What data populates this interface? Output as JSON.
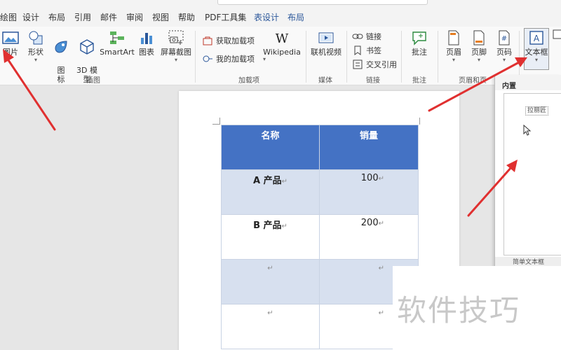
{
  "menu": {
    "tabs": [
      "绘图",
      "设计",
      "布局",
      "引用",
      "邮件",
      "审阅",
      "视图",
      "帮助",
      "PDF工具集",
      "表设计",
      "布局"
    ]
  },
  "ribbon": {
    "buttons": {
      "picture": "图片",
      "shapes": "形状",
      "icons": "图\n标",
      "model3d": "3D 模\n型",
      "smartart": "SmartArt",
      "chart": "图表",
      "screenshot": "屏幕截图",
      "wikipedia": "Wikipedia",
      "online_video": "联机视频",
      "comment": "批注",
      "header": "页眉",
      "footer": "页脚",
      "page_number": "页码",
      "textbox": "文本框"
    },
    "small": {
      "get_addins": "获取加载项",
      "my_addins": "我的加载项",
      "link": "链接",
      "bookmark": "书签",
      "cross_ref": "交叉引用"
    },
    "groups": {
      "illustrations": "插图",
      "addins": "加载项",
      "media": "媒体",
      "links": "链接",
      "comments": "批注",
      "header_footer": "页眉和页"
    },
    "colors": {
      "accent": "#2b579a",
      "table_header": "#4472c4",
      "band": "#d7e0ef",
      "arrow": "#e03030"
    }
  },
  "table": {
    "headers": [
      "名称",
      "销量"
    ],
    "rows": [
      {
        "name": "A 产品",
        "value": "100"
      },
      {
        "name": "B 产品",
        "value": "200"
      },
      {
        "name": "",
        "value": ""
      },
      {
        "name": "",
        "value": ""
      }
    ],
    "para_mark": "↵"
  },
  "gallery": {
    "header": "内置",
    "first_item": "拉丽匠",
    "second_section": "简单文本框"
  },
  "watermark": "软件技巧"
}
